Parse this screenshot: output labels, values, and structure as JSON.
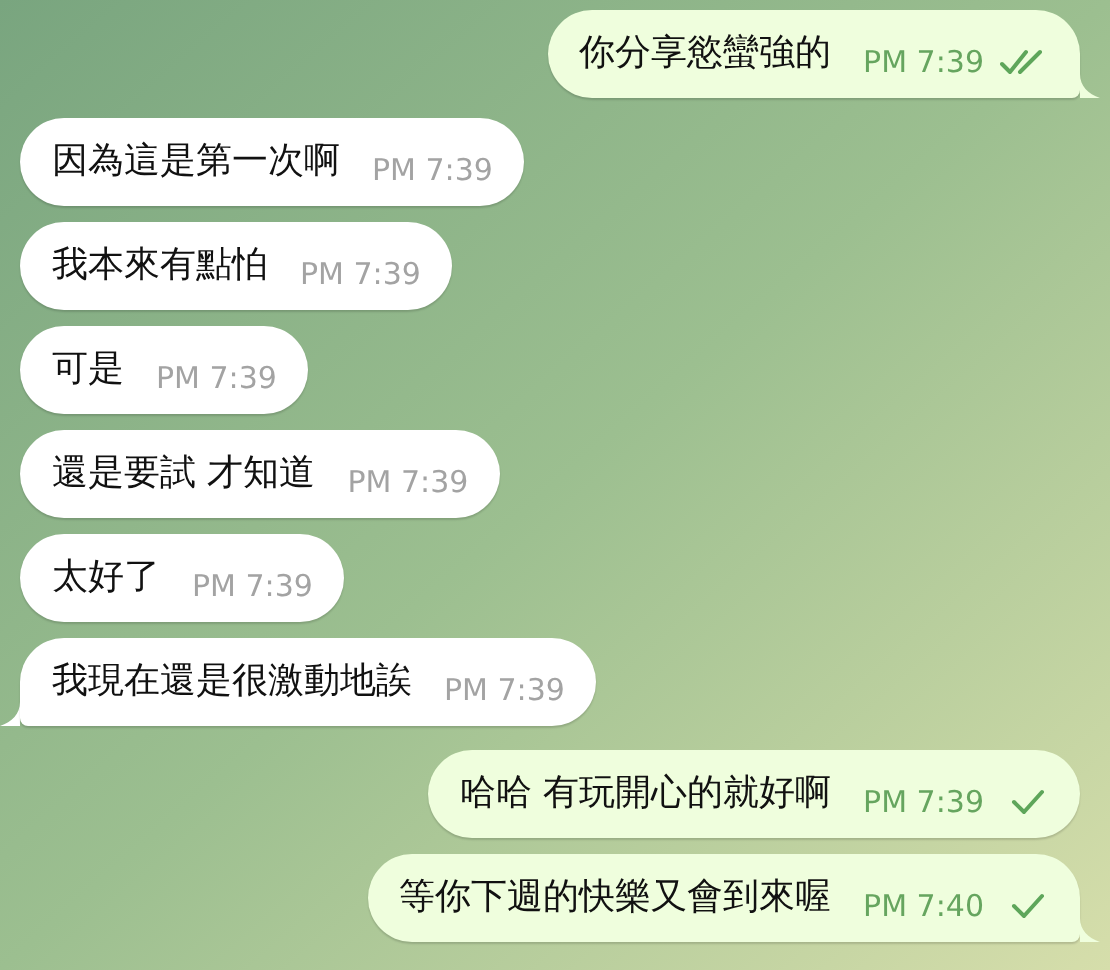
{
  "messages": [
    {
      "kind": "out",
      "text": "你分享慾蠻強的",
      "time": "PM 7:39",
      "read": true,
      "tail": true
    },
    {
      "kind": "in",
      "text": "因為這是第一次啊",
      "time": "PM 7:39",
      "tail": false
    },
    {
      "kind": "in",
      "text": "我本來有點怕",
      "time": "PM 7:39",
      "tail": false
    },
    {
      "kind": "in",
      "text": "可是",
      "time": "PM 7:39",
      "tail": false
    },
    {
      "kind": "in",
      "text": "還是要試 才知道",
      "time": "PM 7:39",
      "tail": false
    },
    {
      "kind": "in",
      "text": "太好了",
      "time": "PM 7:39",
      "tail": false
    },
    {
      "kind": "in",
      "text": "我現在還是很激動地誒",
      "time": "PM 7:39",
      "tail": true
    },
    {
      "kind": "out",
      "text": "哈哈 有玩開心的就好啊",
      "time": "PM 7:39",
      "read": false,
      "tail": false
    },
    {
      "kind": "out",
      "text": "等你下週的快樂又會到來喔",
      "time": "PM 7:40",
      "read": false,
      "tail": true
    }
  ]
}
